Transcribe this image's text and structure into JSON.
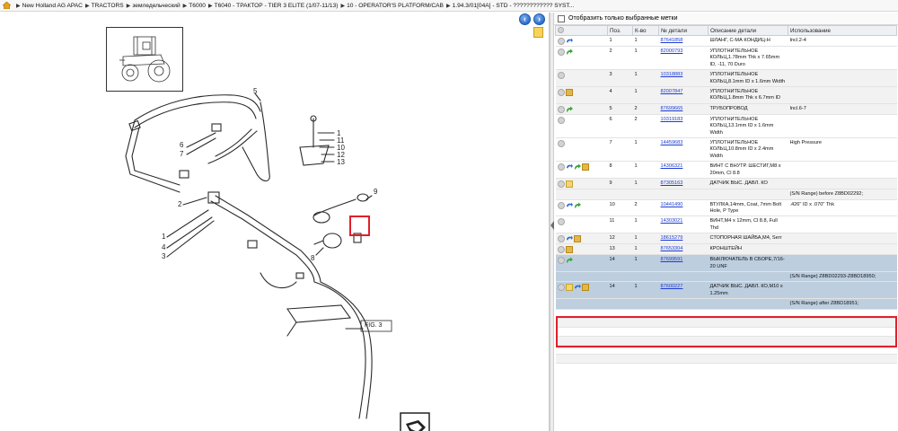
{
  "breadcrumb": [
    "New Holland AG APAC",
    "TRACTORS",
    "земледельческий",
    "T6000",
    "T6040 - ТРАКТОР - TIER 3 ELITE (1/07-11/13)",
    "10 - OPERATOR'S PLATFORM/CAB",
    "1.94.3/01[04A] - STD - ???????????? SYST..."
  ],
  "filter": {
    "label": "Отобразить только выбранные метки"
  },
  "table": {
    "headers": [
      "Поз.",
      "К-во",
      "№ детали",
      "Описание детали",
      "Использование"
    ],
    "rows": [
      {
        "icons": [
          "dot",
          "arrow-blue"
        ],
        "pos": "1",
        "qty": "1",
        "part": "87641858",
        "desc": "ШЛАНГ, С-МА КОНДИЦ-Н",
        "usage": "Incl.2-4",
        "alt": false
      },
      {
        "icons": [
          "dot",
          "arrow-green"
        ],
        "pos": "2",
        "qty": "1",
        "part": "82000793",
        "desc": "УПЛОТНИТЕЛЬНОЕ КОЛЬЦ,1.78mm Thk x 7.65mm ID, -11, 70 Duro",
        "usage": "",
        "alt": false
      },
      {
        "icons": [
          "dot"
        ],
        "pos": "3",
        "qty": "1",
        "part": "10318883",
        "desc": "УПЛОТНИТЕЛЬНОЕ КОЛЬЦ,8.1mm ID x 1.6mm Width",
        "usage": "",
        "alt": true
      },
      {
        "icons": [
          "dot",
          "box"
        ],
        "pos": "4",
        "qty": "1",
        "part": "82007847",
        "desc": "УПЛОТНИТЕЛЬНОЕ КОЛЬЦ,1.8mm Thk x 6.7mm ID",
        "usage": "",
        "alt": true
      },
      {
        "icons": [
          "dot",
          "arrow-green"
        ],
        "pos": "5",
        "qty": "2",
        "part": "87699665",
        "desc": "ТРУБОПРОВОД",
        "usage": "Incl.6-7",
        "alt": true
      },
      {
        "icons": [
          "dot"
        ],
        "pos": "6",
        "qty": "2",
        "part": "10319183",
        "desc": "УПЛОТНИТЕЛЬНОЕ КОЛЬЦ,13.1mm ID x 1.6mm Width",
        "usage": "",
        "alt": false
      },
      {
        "icons": [
          "dot"
        ],
        "pos": "7",
        "qty": "1",
        "part": "14459683",
        "desc": "УПЛОТНИТЕЛЬНОЕ КОЛЬЦ,10.8mm ID x 2.4mm Width",
        "usage": "High Pressure",
        "alt": false
      },
      {
        "icons": [
          "dot",
          "arrow-blue",
          "arrow-green",
          "box"
        ],
        "pos": "8",
        "qty": "1",
        "part": "14306321",
        "desc": "ВИНТ С ВНУТР. ШЕСТИГ,M8 x 20mm, Cl 8.8",
        "usage": "",
        "alt": false
      },
      {
        "icons": [
          "dot",
          "note"
        ],
        "pos": "9",
        "qty": "1",
        "part": "87305163",
        "desc": "ДАТЧИК ВЫС. ДАВЛ. КО",
        "usage": "",
        "alt": true,
        "extra": "(S/N Range) before Z8BD02292;"
      },
      {
        "icons": [
          "dot",
          "arrow-blue",
          "arrow-green"
        ],
        "pos": "10",
        "qty": "2",
        "part": "10441490",
        "desc": "ВТУЛКА,14mm, Coat, 7mm Bolt Hole, P Type",
        "usage": ".426\" ID x .070\" Thk",
        "alt": false
      },
      {
        "icons": [
          "dot"
        ],
        "pos": "11",
        "qty": "1",
        "part": "14303021",
        "desc": "ВИНТ,M4 x 12mm, Cl 8.8, Full Thd",
        "usage": "",
        "alt": false
      },
      {
        "icons": [
          "dot",
          "arrow-blue",
          "box"
        ],
        "pos": "12",
        "qty": "1",
        "part": "18615279",
        "desc": "СТОПОРНАЯ ШАЙБА,M4, Serr",
        "usage": "",
        "alt": true
      },
      {
        "icons": [
          "dot",
          "box"
        ],
        "pos": "13",
        "qty": "1",
        "part": "87653304",
        "desc": "КРОНШТЕЙН",
        "usage": "",
        "alt": true
      },
      {
        "icons": [
          "dot",
          "arrow-green"
        ],
        "pos": "14",
        "qty": "1",
        "part": "87699591",
        "desc": "ВЫКЛЮЧАТЕЛЬ В СБОРЕ,7/16-20 UNF",
        "usage": "",
        "alt": false,
        "sel": true,
        "extra": "(S/N Range) Z8BD02293-Z8BD18950;"
      },
      {
        "icons": [
          "dot",
          "note",
          "arrow-blue",
          "box"
        ],
        "pos": "14",
        "qty": "1",
        "part": "87600227",
        "desc": "ДАТЧИК ВЫС. ДАВЛ. КО,M10 x 1.25mm",
        "usage": "",
        "alt": false,
        "hl": true,
        "extra": "(S/N Range) after Z8BD18951;"
      }
    ]
  },
  "drawing": {
    "callouts": [
      "5",
      "1",
      "11",
      "12",
      "13",
      "10",
      "6",
      "7",
      "2",
      "3",
      "4",
      "1",
      "9",
      "8",
      "12",
      "11",
      "13",
      "10",
      "6"
    ],
    "figure_label": "FIG. 3",
    "hose_label": "5"
  },
  "colors": {
    "highlight": "#e0202a",
    "selected_row": "#bdcedf",
    "link": "#1d3bd3"
  }
}
